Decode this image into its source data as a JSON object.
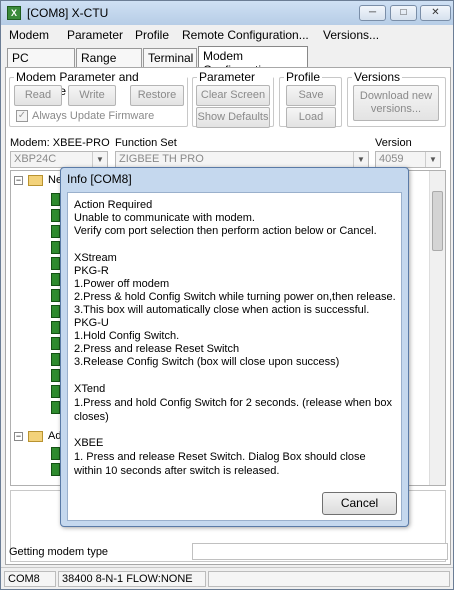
{
  "window": {
    "title": "[COM8] X-CTU",
    "minimize_label": "─",
    "maximize_label": "□",
    "close_label": "✕"
  },
  "menu": [
    "Modem",
    "Parameter",
    "Profile",
    "Remote Configuration...",
    "Versions..."
  ],
  "tabs": [
    "PC Settings",
    "Range Test",
    "Terminal",
    "Modem Configuration"
  ],
  "groups": {
    "firmware": {
      "label": "Modem Parameter and Firmware",
      "read": "Read",
      "write": "Write",
      "restore": "Restore",
      "always_update": "Always Update Firmware"
    },
    "view": {
      "label": "Parameter View",
      "clear": "Clear Screen",
      "defaults": "Show Defaults"
    },
    "profile": {
      "label": "Profile",
      "save": "Save",
      "load": "Load"
    },
    "versions": {
      "label": "Versions",
      "download": "Download new versions..."
    }
  },
  "modem_row": {
    "modem_label": "Modem: XBEE-PRO",
    "function_label": "Function Set",
    "version_label": "Version",
    "modem_value": "XBP24C",
    "function_value": "ZIGBEE TH PRO",
    "version_value": "4059"
  },
  "tree": {
    "node1": "Ne",
    "node2": "Ad"
  },
  "status": {
    "message": "Getting modem type",
    "port": "COM8",
    "settings": "38400 8-N-1  FLOW:NONE"
  },
  "dialog": {
    "title": "Info  [COM8]",
    "cancel": "Cancel",
    "lines": [
      "Action Required",
      "Unable to communicate with modem.",
      "Verify com port selection then perform action below or Cancel.",
      "XStream",
      "   PKG-R",
      "   1.Power off modem",
      "   2.Press & hold Config Switch while turning power on,then release.",
      "   3.This box will automatically close when action is successful.",
      "   PKG-U",
      "   1.Hold Config Switch.",
      "   2.Press and release Reset Switch",
      "   3.Release Config Switch (box will close upon success)",
      "XTend",
      "1.Press and hold Config Switch for 2 seconds. (release when box closes)",
      "XBEE",
      " 1. Press and release Reset Switch. Dialog Box should close within 10 seconds after switch is released."
    ]
  }
}
